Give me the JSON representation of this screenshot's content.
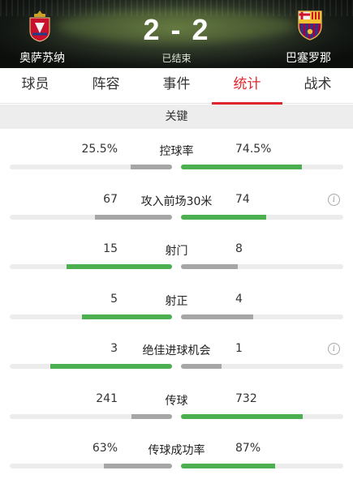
{
  "match": {
    "home_team": "奥萨苏纳",
    "away_team": "巴塞罗那",
    "score": "2 - 2",
    "status": "已结束"
  },
  "tabs": [
    {
      "label": "球员",
      "active": false
    },
    {
      "label": "阵容",
      "active": false
    },
    {
      "label": "事件",
      "active": false
    },
    {
      "label": "统计",
      "active": true
    },
    {
      "label": "战术",
      "active": false
    }
  ],
  "section": {
    "title": "关键"
  },
  "stats": [
    {
      "label": "控球率",
      "home": "25.5%",
      "away": "74.5%",
      "home_fraction": 0.255,
      "away_fraction": 0.745,
      "leader": "away",
      "info": false
    },
    {
      "label": "攻入前场30米",
      "home": "67",
      "away": "74",
      "home_fraction": 0.475,
      "away_fraction": 0.525,
      "leader": "away",
      "info": true
    },
    {
      "label": "射门",
      "home": "15",
      "away": "8",
      "home_fraction": 0.652,
      "away_fraction": 0.348,
      "leader": "home",
      "info": false
    },
    {
      "label": "射正",
      "home": "5",
      "away": "4",
      "home_fraction": 0.556,
      "away_fraction": 0.444,
      "leader": "home",
      "info": false
    },
    {
      "label": "绝佳进球机会",
      "home": "3",
      "away": "1",
      "home_fraction": 0.75,
      "away_fraction": 0.25,
      "leader": "home",
      "info": true
    },
    {
      "label": "传球",
      "home": "241",
      "away": "732",
      "home_fraction": 0.248,
      "away_fraction": 0.752,
      "leader": "away",
      "info": false
    },
    {
      "label": "传球成功率",
      "home": "63%",
      "away": "87%",
      "home_fraction": 0.42,
      "away_fraction": 0.58,
      "leader": "away",
      "info": false
    }
  ],
  "colors": {
    "accent": "#e0262d",
    "leader_bar": "#4caf50",
    "trailing_bar": "#a6a6a6",
    "bar_track": "#ececec"
  },
  "icons": {
    "info": "info-icon",
    "home_crest": "osasuna-crest",
    "away_crest": "barcelona-crest"
  }
}
